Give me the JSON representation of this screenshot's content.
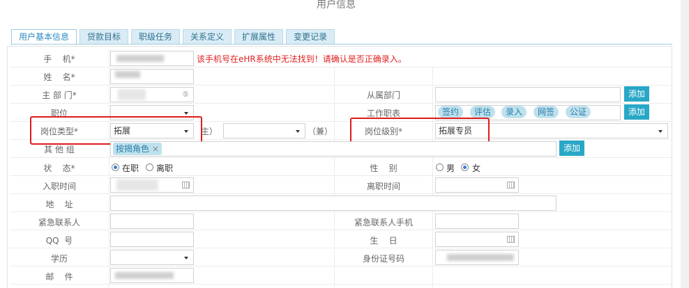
{
  "page": {
    "title": "用户信息"
  },
  "tabs": [
    {
      "label": "用户基本信息",
      "active": true
    },
    {
      "label": "贷款目标",
      "active": false
    },
    {
      "label": "职级任务",
      "active": false
    },
    {
      "label": "关系定义",
      "active": false
    },
    {
      "label": "扩展属性",
      "active": false
    },
    {
      "label": "变更记录",
      "active": false
    }
  ],
  "form": {
    "phone": {
      "label": "手    机*",
      "error": "该手机号在eHR系统中无法找到！请确认是否正确录入。"
    },
    "name": {
      "label": "姓    名*"
    },
    "main_dept": {
      "label": "主 部 门*",
      "icon_label": "⑤"
    },
    "sub_dept": {
      "label": "从属部门",
      "add_label": "添加"
    },
    "position": {
      "label": "职位"
    },
    "work_table": {
      "label": "工作职表",
      "chips": [
        "签约",
        "评估",
        "录入",
        "网签",
        "公证"
      ],
      "add_label": "添加"
    },
    "position_type": {
      "label": "岗位类型*",
      "value": "拓展",
      "main_suffix": "主）",
      "part_suffix": "（兼）"
    },
    "position_level": {
      "label": "岗位级别*",
      "value": "拓展专员"
    },
    "other_group": {
      "label": "其 他 组",
      "chip": "按揭角色",
      "add_label": "添加"
    },
    "status": {
      "label": "状    态*",
      "options": [
        "在职",
        "离职"
      ],
      "selected": "在职"
    },
    "gender": {
      "label": "性    别",
      "options": [
        "男",
        "女"
      ],
      "selected": "女"
    },
    "join_date": {
      "label": "入职时间"
    },
    "leave_date": {
      "label": "离职时间"
    },
    "address": {
      "label": "地    址"
    },
    "emergency_contact": {
      "label": "紧急联系人"
    },
    "emergency_phone": {
      "label": "紧急联系人手机"
    },
    "qq": {
      "label": "QQ  号"
    },
    "birthday": {
      "label": "生    日"
    },
    "education": {
      "label": "学历"
    },
    "id_card": {
      "label": "身份证号码"
    },
    "email": {
      "label": "邮    件"
    }
  },
  "colors": {
    "accent": "#28a7c7",
    "error": "#e02020",
    "highlight_box": "#e01a1a"
  }
}
